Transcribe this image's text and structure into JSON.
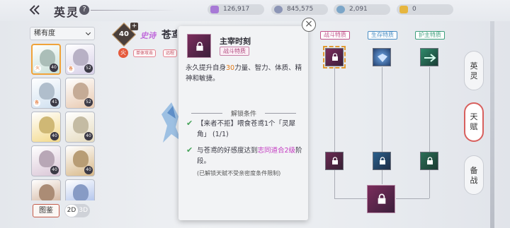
{
  "header": {
    "title": "英灵",
    "help_glyph": "?"
  },
  "resources": [
    {
      "name": "crystal",
      "value": "126,917",
      "color": "#a779d6"
    },
    {
      "name": "coin",
      "value": "845,575",
      "color": "#8c95b6"
    },
    {
      "name": "token",
      "value": "2,091",
      "color": "#7ca6c8"
    },
    {
      "name": "gold-ticket",
      "value": "0",
      "color": "#e6b63f"
    }
  ],
  "sidebar": {
    "sort_label": "稀有度",
    "cards": [
      {
        "level": "40",
        "color": "#c9e0d8",
        "selected": true,
        "element": "火"
      },
      {
        "level": "52",
        "color": "#d8d0e8",
        "selected": false,
        "element": "备"
      },
      {
        "level": "41",
        "color": "#cfe0f0",
        "selected": false,
        "element": "备"
      },
      {
        "level": "52",
        "color": "#e8c9b0",
        "selected": false,
        "element": ""
      },
      {
        "level": "40",
        "color": "#f3d98a",
        "selected": false,
        "element": ""
      },
      {
        "level": "40",
        "color": "#e6dcc0",
        "selected": false,
        "element": ""
      },
      {
        "level": "40",
        "color": "#d9c5d6",
        "selected": false,
        "element": ""
      },
      {
        "level": "40",
        "color": "#d8b98a",
        "selected": false,
        "element": ""
      },
      {
        "level": "",
        "color": "#c9a58a",
        "selected": false,
        "element": ""
      },
      {
        "level": "",
        "color": "#9fb6e8",
        "selected": false,
        "element": ""
      }
    ],
    "atlas_label": "图鉴",
    "mode_2d": "2D",
    "mode_3d": "3D"
  },
  "hero": {
    "level": "40",
    "plus": "+",
    "rarity": "史诗",
    "name": "苍鸢",
    "element": "火",
    "tags": [
      "单体攻击",
      "远程"
    ]
  },
  "popup": {
    "name": "主宰时刻",
    "type": "战斗特质",
    "desc_before": "永久提升自身",
    "desc_value": "30",
    "desc_after": "力量、智力、体质、精神和敏捷。",
    "unlock_title": "解锁条件",
    "cond1": "【来者不拒】喂食苍鸢1个「灵犀角」 (1/1)",
    "cond2_before": "与苍鸢的好感度达到",
    "cond2_highlight": "志同道合2级",
    "cond2_after": "阶段。",
    "note": "(已解锁天赋不受亲密度条件限制)",
    "close_glyph": "×"
  },
  "tree": {
    "tabs": [
      {
        "label": "战斗特质",
        "color": "#c0528a"
      },
      {
        "label": "生存特质",
        "color": "#4a8ec4"
      },
      {
        "label": "护主特质",
        "color": "#3fa07e"
      }
    ]
  },
  "right_tabs": [
    {
      "label": "英灵",
      "active": false
    },
    {
      "label": "天赋",
      "active": true
    },
    {
      "label": "备战",
      "active": false
    }
  ]
}
